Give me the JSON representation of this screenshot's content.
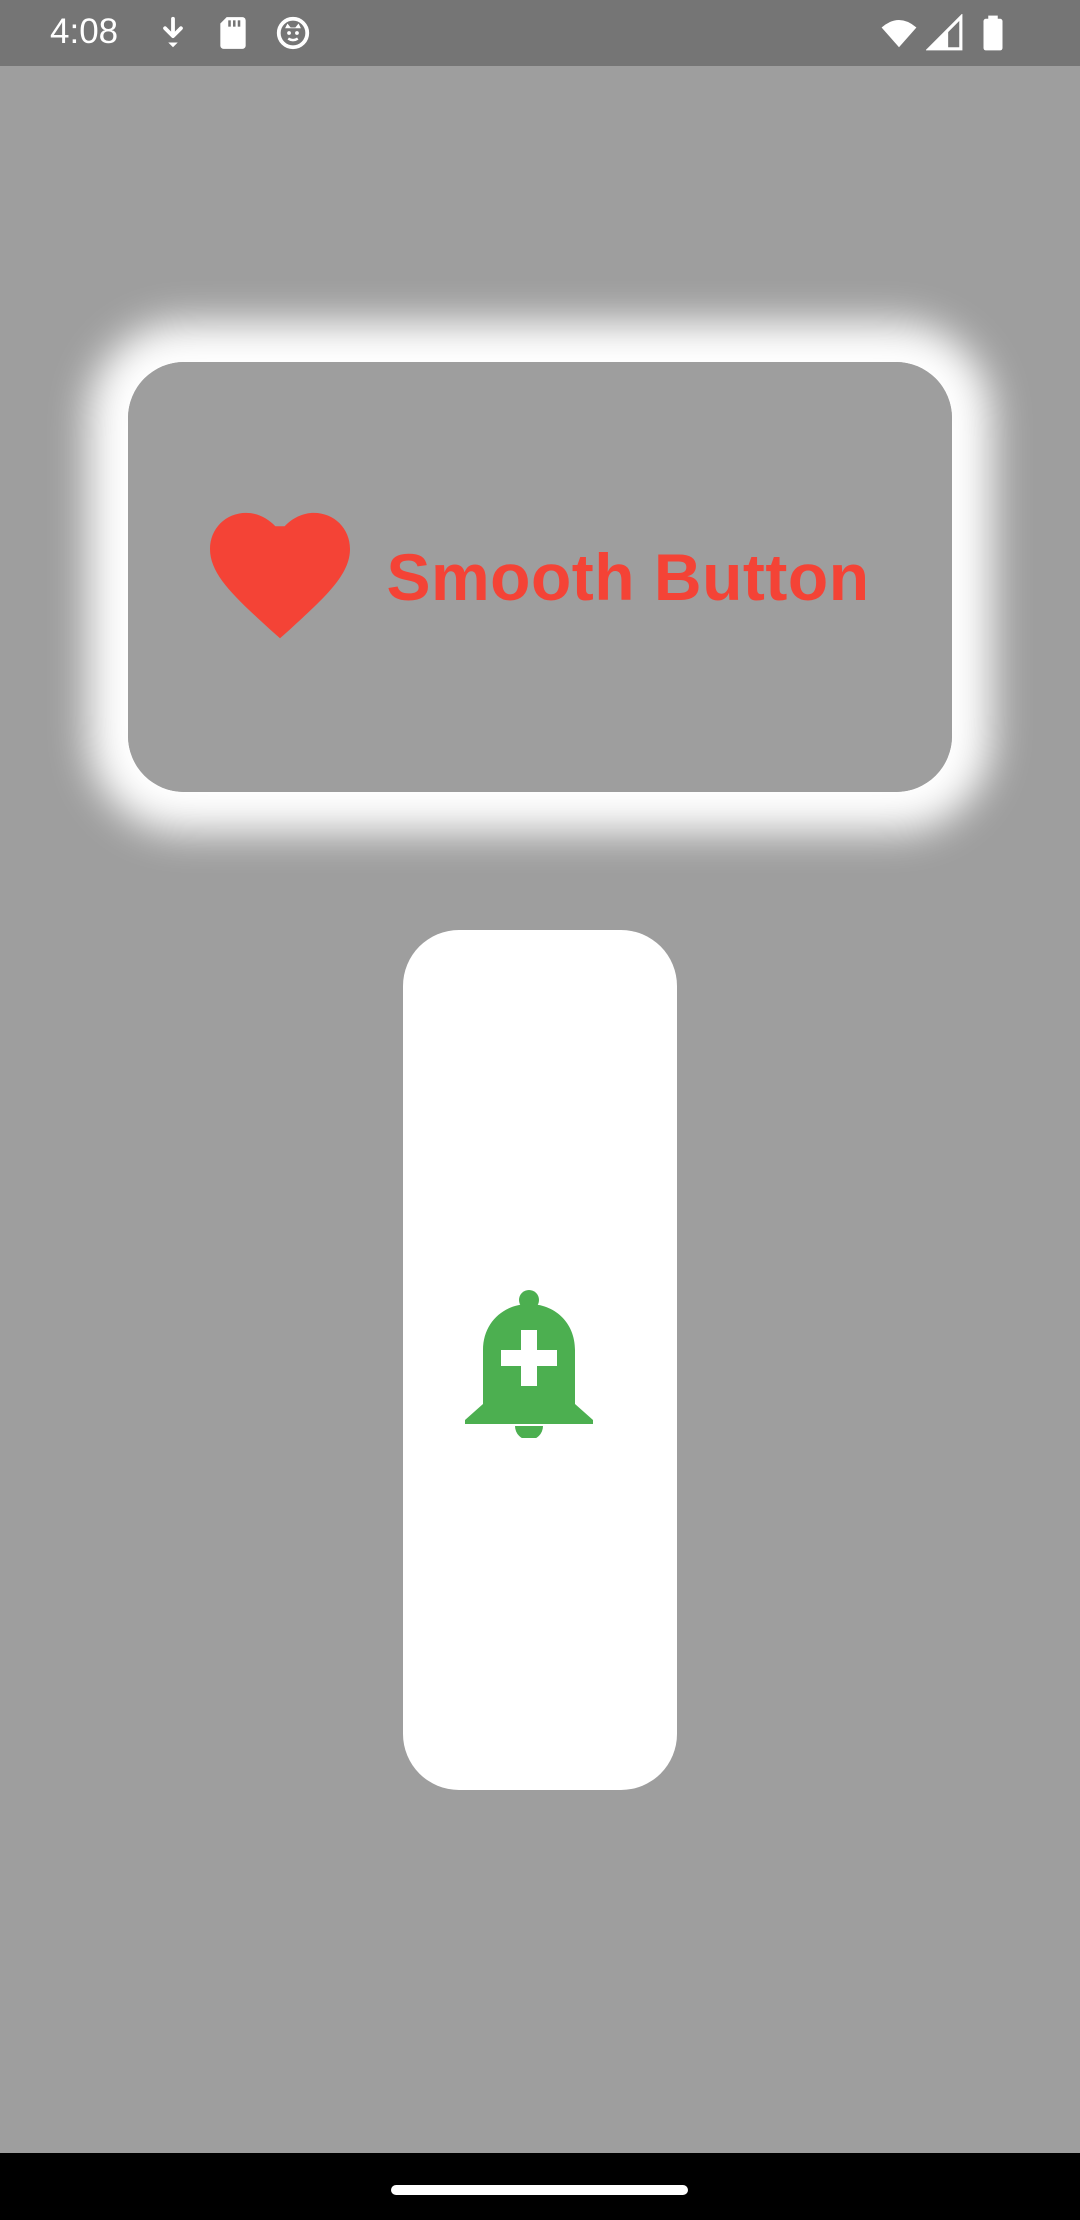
{
  "status_bar": {
    "time": "4:08",
    "icons_left": [
      "download-icon",
      "sd-card-icon",
      "cat-face-icon"
    ],
    "icons_right": [
      "wifi-icon",
      "signal-icon",
      "battery-icon"
    ]
  },
  "smooth_button": {
    "label": "Smooth Button",
    "icon": "heart-icon",
    "accent_color": "#f44336"
  },
  "bell_button": {
    "icon": "add-alert-bell-icon",
    "icon_color": "#4caf50"
  },
  "colors": {
    "background": "#9e9e9e",
    "status_bar": "#757575",
    "card": "#ffffff"
  }
}
